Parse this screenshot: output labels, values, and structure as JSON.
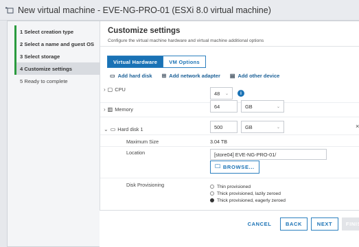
{
  "window": {
    "title": "New virtual machine - EVE-NG-PRO-01 (ESXi 8.0 virtual machine)",
    "icon": "new-vm-icon"
  },
  "steps": [
    {
      "label": "1  Select creation type",
      "state": "done"
    },
    {
      "label": "2  Select a name and guest OS",
      "state": "done"
    },
    {
      "label": "3  Select storage",
      "state": "done"
    },
    {
      "label": "4  Customize settings",
      "state": "active"
    },
    {
      "label": "5  Ready to complete",
      "state": "pending"
    }
  ],
  "page": {
    "title": "Customize settings",
    "subtitle": "Configure the virtual machine hardware and virtual machine additional options"
  },
  "tabs": [
    {
      "label": "Virtual Hardware",
      "active": true
    },
    {
      "label": "VM Options",
      "active": false
    }
  ],
  "toolbar": {
    "add_hard_disk": "Add hard disk",
    "add_network_adapter": "Add network adapter",
    "add_other_device": "Add other device"
  },
  "hardware": {
    "cpu": {
      "label": "CPU",
      "value": "48"
    },
    "memory": {
      "label": "Memory",
      "value": "64",
      "unit": "GB"
    },
    "hard_disk": {
      "label": "Hard disk 1",
      "value": "500",
      "unit": "GB",
      "max_size_label": "Maximum Size",
      "max_size_value": "3.04 TB",
      "location_label": "Location",
      "location_value": "[store04] EVE-NG-PRO-01/",
      "browse_label": "BROWSE...",
      "provisioning_label": "Disk Provisioning",
      "provisioning_options": [
        {
          "label": "Thin provisioned",
          "selected": false
        },
        {
          "label": "Thick provisioned, lazily zeroed",
          "selected": false
        },
        {
          "label": "Thick provisioned, eagerly zeroed",
          "selected": true
        }
      ],
      "remove_symbol": "×"
    }
  },
  "footer": {
    "cancel": "CANCEL",
    "back": "BACK",
    "next": "NEXT",
    "finish": "FINISH"
  },
  "colors": {
    "accent": "#1a72b5",
    "step_marker": "#2a9b3e"
  }
}
